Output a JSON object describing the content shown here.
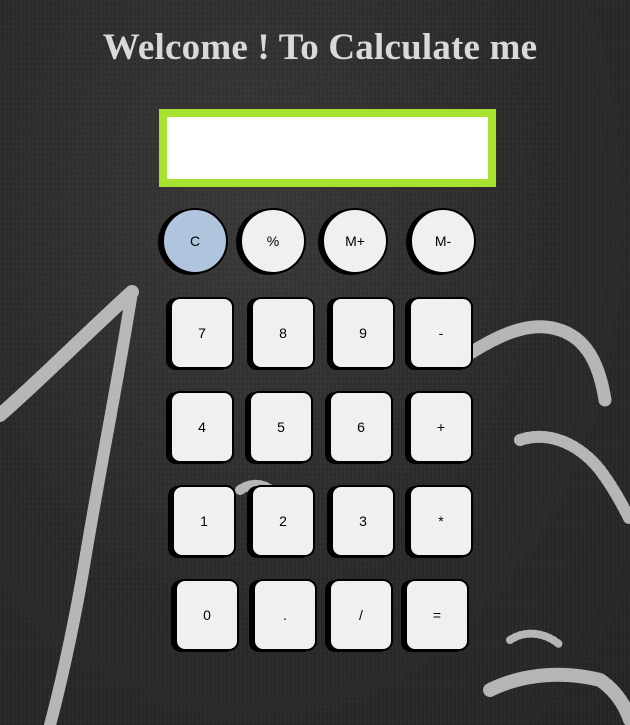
{
  "page": {
    "title": "Welcome ! To Calculate me"
  },
  "display": {
    "value": ""
  },
  "buttons": {
    "top_row": [
      "C",
      "%",
      "M+",
      "M-"
    ],
    "row1": [
      "7",
      "8",
      "9",
      "-"
    ],
    "row2": [
      "4",
      "5",
      "6",
      "+"
    ],
    "row3": [
      "1",
      "2",
      "3",
      "*"
    ],
    "row4": [
      "0",
      ".",
      "/",
      "="
    ]
  },
  "colors": {
    "display_border": "#a6e22e",
    "clear_button": "#b0c4de",
    "button_face": "#f0f0f0",
    "title_text": "#d9d9d9"
  }
}
